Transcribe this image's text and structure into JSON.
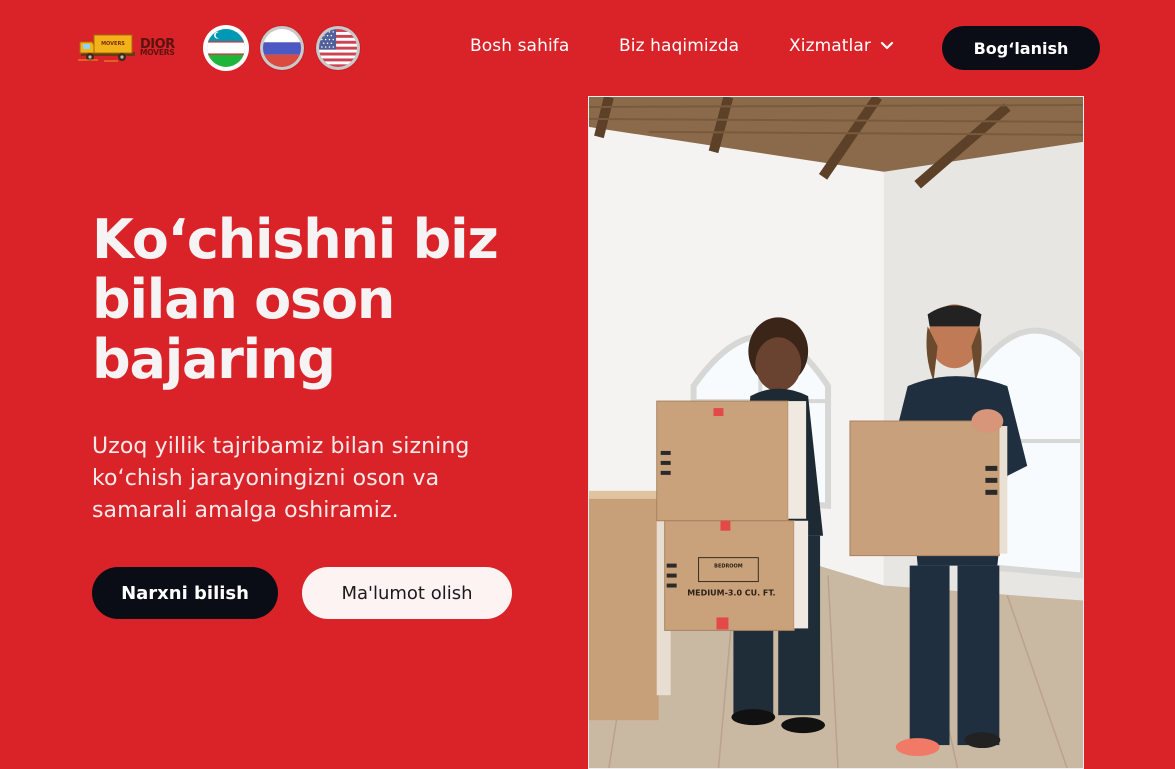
{
  "brand": {
    "name_line1": "DIOR",
    "name_line2": "MOVERS",
    "truck_text": "MOVERS"
  },
  "languages": [
    {
      "icon": "uzbekistan-flag-icon",
      "active": true
    },
    {
      "icon": "russia-flag-icon",
      "active": false
    },
    {
      "icon": "usa-flag-icon",
      "active": false
    }
  ],
  "nav": {
    "home": "Bosh sahifa",
    "about": "Biz haqimizda",
    "services": "Xizmatlar",
    "services_icon": "chevron-down-icon",
    "contact": "Bog‘lanish"
  },
  "hero": {
    "title": "Ko‘chishni biz bilan oson bajaring",
    "subtitle": "Uzoq yillik tajribamiz bilan sizning ko‘chish jarayoningizni oson va samarali amalga oshiramiz.",
    "primary_button": "Narxni bilish",
    "secondary_button": "Ma'lumot olish"
  },
  "photo": {
    "box_label_1": "MEDIUM-3.0 CU. FT.",
    "box_label_2": "BEDROOM"
  },
  "colors": {
    "background": "#d92328",
    "dark": "#0b0d16",
    "light_button": "#fdf3f2"
  }
}
